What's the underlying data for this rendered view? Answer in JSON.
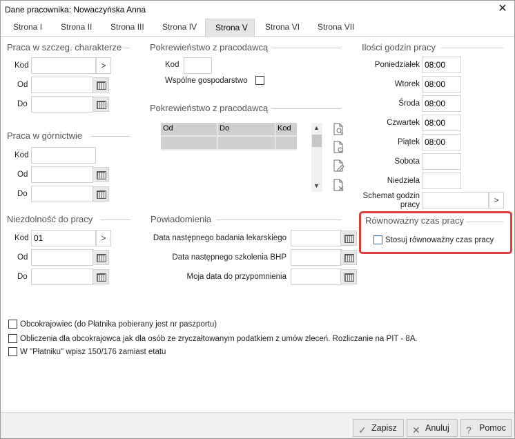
{
  "window": {
    "title": "Dane pracownika: Nowaczyńska Anna",
    "close": "✕"
  },
  "tabs": [
    {
      "label": "Strona I"
    },
    {
      "label": "Strona II"
    },
    {
      "label": "Strona III"
    },
    {
      "label": "Strona IV"
    },
    {
      "label": "Strona V"
    },
    {
      "label": "Strona VI"
    },
    {
      "label": "Strona VII"
    }
  ],
  "active_tab": "Strona V",
  "praca_szczeg": {
    "title": "Praca w szczeg. charakterze",
    "kod": "Kod",
    "od": "Od",
    "do": "Do"
  },
  "praca_gornictwie": {
    "title": "Praca w górnictwie",
    "kod": "Kod",
    "od": "Od",
    "do": "Do"
  },
  "niezdolnosc": {
    "title": "Niezdolność do pracy",
    "kod": "Kod",
    "kod_value": "01",
    "od": "Od",
    "do": "Do"
  },
  "pokrewienstwo1": {
    "title": "Pokrewieństwo z pracodawcą",
    "kod": "Kod",
    "wspolne": "Wspólne gospodarstwo"
  },
  "pokrewienstwo2": {
    "title": "Pokrewieństwo z pracodawcą",
    "columns": [
      "Od",
      "Do",
      "Kod"
    ]
  },
  "powiadomienia": {
    "title": "Powiadomienia",
    "badanie": "Data następnego badania lekarskiego",
    "bhp": "Data następnego szkolenia BHP",
    "moja": "Moja data do przypomnienia"
  },
  "godziny": {
    "title": "Ilości godzin pracy",
    "days": [
      {
        "label": "Poniedziałek",
        "value": "08:00"
      },
      {
        "label": "Wtorek",
        "value": "08:00"
      },
      {
        "label": "Środa",
        "value": "08:00"
      },
      {
        "label": "Czwartek",
        "value": "08:00"
      },
      {
        "label": "Piątek",
        "value": "08:00"
      },
      {
        "label": "Sobota",
        "value": ""
      },
      {
        "label": "Niedziela",
        "value": ""
      }
    ],
    "schemat_line1": "Schemat godzin",
    "schemat_line2": "pracy"
  },
  "rownowazny": {
    "title": "Równoważny czas pracy",
    "checkbox": "Stosuj równoważny czas pracy"
  },
  "options": {
    "obcokrajowiec": "Obcokrajowiec (do Płatnika pobierany jest nr paszportu)",
    "obliczenia": "Obliczenia dla obcokrajowca jak dla osób ze zryczałtowanym podatkiem z umów zleceń. Rozliczanie na PIT - 8A.",
    "platnik": "W \"Płatniku\" wpisz 150/176 zamiast etatu"
  },
  "footer": {
    "zapisz": "Zapisz",
    "anuluj": "Anuluj",
    "pomoc": "Pomoc"
  },
  "colors": {
    "highlight_border": "#e03b3b",
    "checkbox_blue": "#2a6fd0"
  }
}
